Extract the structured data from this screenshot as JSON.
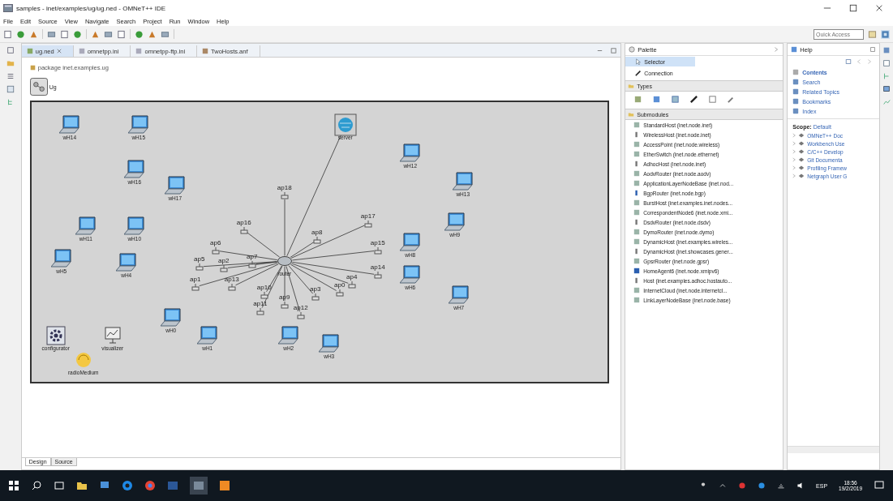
{
  "window": {
    "title": "samples - inet/examples/ug/ug.ned - OMNeT++ IDE"
  },
  "menu": [
    "File",
    "Edit",
    "Source",
    "View",
    "Navigate",
    "Search",
    "Project",
    "Run",
    "Window",
    "Help"
  ],
  "quick_access": {
    "placeholder": "Quick Access"
  },
  "editor_tabs": [
    {
      "label": "ug.ned",
      "selected": true
    },
    {
      "label": "omnetpp.ini",
      "selected": false
    },
    {
      "label": "omnetpp-ftp.ini",
      "selected": false
    },
    {
      "label": "TwoHosts.anf",
      "selected": false
    }
  ],
  "package": "package inet.examples.ug",
  "network": {
    "name": "Ug",
    "nodes": [
      {
        "label": "wH14",
        "kind": "laptop"
      },
      {
        "label": "wH15",
        "kind": "laptop"
      },
      {
        "label": "server",
        "kind": "server"
      },
      {
        "label": "wH12",
        "kind": "laptop"
      },
      {
        "label": "wH13",
        "kind": "laptop"
      },
      {
        "label": "wH16",
        "kind": "laptop"
      },
      {
        "label": "wH17",
        "kind": "laptop"
      },
      {
        "label": "wH11",
        "kind": "laptop"
      },
      {
        "label": "wH10",
        "kind": "laptop"
      },
      {
        "label": "wH9",
        "kind": "laptop"
      },
      {
        "label": "wH8",
        "kind": "laptop"
      },
      {
        "label": "wH5",
        "kind": "laptop"
      },
      {
        "label": "wH4",
        "kind": "laptop"
      },
      {
        "label": "wH6",
        "kind": "laptop"
      },
      {
        "label": "wH7",
        "kind": "laptop"
      },
      {
        "label": "wH0",
        "kind": "laptop"
      },
      {
        "label": "wH1",
        "kind": "laptop"
      },
      {
        "label": "wH2",
        "kind": "laptop"
      },
      {
        "label": "wH3",
        "kind": "laptop"
      },
      {
        "label": "configurator",
        "kind": "configurator"
      },
      {
        "label": "visualizer",
        "kind": "visualizer"
      },
      {
        "label": "radioMedium",
        "kind": "medium"
      },
      {
        "label": "ap18",
        "kind": "ap"
      },
      {
        "label": "ap17",
        "kind": "ap"
      },
      {
        "label": "ap16",
        "kind": "ap"
      },
      {
        "label": "ap6",
        "kind": "ap"
      },
      {
        "label": "ap15",
        "kind": "ap"
      },
      {
        "label": "ap5",
        "kind": "ap"
      },
      {
        "label": "ap14",
        "kind": "ap"
      },
      {
        "label": "ap1",
        "kind": "ap"
      },
      {
        "label": "ap13",
        "kind": "ap"
      },
      {
        "label": "ap10",
        "kind": "ap"
      },
      {
        "label": "ap11",
        "kind": "ap"
      },
      {
        "label": "ap12",
        "kind": "ap"
      },
      {
        "label": "ap9",
        "kind": "ap"
      },
      {
        "label": "ap0",
        "kind": "ap"
      },
      {
        "label": "ap2",
        "kind": "ap"
      },
      {
        "label": "ap3",
        "kind": "ap"
      },
      {
        "label": "ap4",
        "kind": "ap"
      },
      {
        "label": "ap7",
        "kind": "ap"
      },
      {
        "label": "ap8",
        "kind": "ap"
      },
      {
        "label": "router",
        "kind": "router"
      }
    ]
  },
  "bottom_tabs": [
    {
      "label": "Design",
      "selected": true
    },
    {
      "label": "Source",
      "selected": false
    }
  ],
  "palette": {
    "title": "Palette",
    "tools": [
      {
        "label": "Selector",
        "selected": true
      },
      {
        "label": "Connection",
        "selected": false
      }
    ],
    "types_header": "Types",
    "submodules_header": "Submodules",
    "submodules": [
      "StandardHost (inet.node.inet)",
      "WirelessHost (inet.node.inet)",
      "AccessPoint (inet.node.wireless)",
      "EtherSwitch (inet.node.ethernet)",
      "AdhocHost (inet.node.inet)",
      "AodvRouter (inet.node.aodv)",
      "ApplicationLayerNodeBase (inet.nod...",
      "BgpRouter (inet.node.bgp)",
      "BurstHost (inet.examples.inet.nodes...",
      "CorrespondentNode6 (inet.node.xmi...",
      "DsdvRouter (inet.node.dsdv)",
      "DymoRouter (inet.node.dymo)",
      "DynamicHost (inet.examples.wireles...",
      "DynamicHost (inet.showcases.gener...",
      "GpsrRouter (inet.node.gpsr)",
      "HomeAgent6 (inet.node.xmipv6)",
      "Host (inet.examples.adhoc.hostauto...",
      "InternetCloud (inet.node.internetcl...",
      "LinkLayerNodeBase (inet.node.base)"
    ]
  },
  "help": {
    "title": "Help",
    "links": [
      {
        "label": "Contents",
        "selected": true
      },
      {
        "label": "Search",
        "selected": false
      },
      {
        "label": "Related Topics",
        "selected": false
      },
      {
        "label": "Bookmarks",
        "selected": false
      },
      {
        "label": "Index",
        "selected": false
      }
    ],
    "scope_label": "Scope:",
    "scope_value": "Default",
    "books": [
      "OMNeT++ Doc",
      "Workbench Use",
      "C/C++ Develop",
      "Git Documenta",
      "Profiling Framew",
      "Netgraph User G"
    ]
  },
  "taskbar": {
    "language": "ESP",
    "time": "18:56",
    "date": "19/2/2019"
  }
}
